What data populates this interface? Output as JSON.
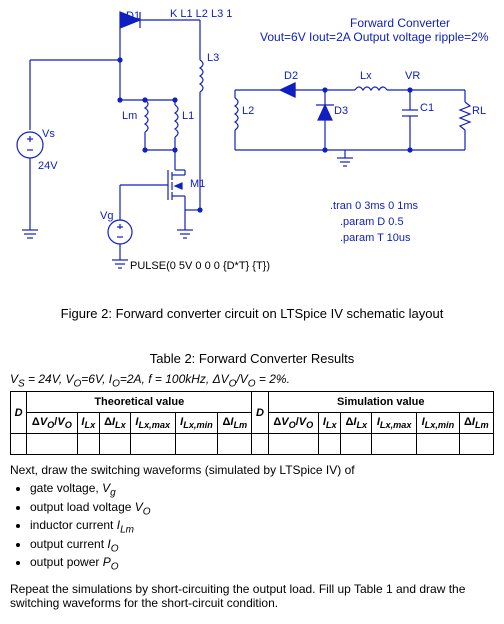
{
  "schematic": {
    "header_coupling": "K L1 L2 L3 1",
    "title1": "Forward Converter",
    "title2": "Vout=6V Iout=2A Output voltage ripple=2%",
    "D1": "D1",
    "D2": "D2",
    "D3": "D3",
    "Lm": "Lm",
    "L1": "L1",
    "L2": "L2",
    "L3": "L3",
    "Lx": "Lx",
    "VR": "VR",
    "C1": "C1",
    "RL": "RL",
    "Vs": "Vs",
    "V24": "24V",
    "M1": "M1",
    "Vg": "Vg",
    "pulse": "PULSE(0 5V 0 0 0 {D*T} {T})",
    "tran": ".tran 0 3ms 0 1ms",
    "paramD": ".param D 0.5",
    "paramT": ".param T 10us"
  },
  "figure_caption": "Figure 2: Forward converter circuit on LTSpice IV schematic layout",
  "table_caption": "Table 2: Forward Converter Results",
  "conditions_html": "V<sub>S</sub> = 24V, V<sub>O</sub>=6V, I<sub>O</sub>=2A, f = 100kHz, ΔV<sub>O</sub>/V<sub>O</sub> = 2%.",
  "table": {
    "group1": "Theoretical value",
    "group2": "Simulation value",
    "cols": [
      "D",
      "ΔV_O/V_O",
      "I_Lx",
      "ΔI_Lx",
      "I_Lx,max",
      "I_Lx,min",
      "ΔI_Lm",
      "D",
      "ΔV_O/V_O",
      "I_Lx",
      "ΔI_Lx",
      "I_Lx,max",
      "I_Lx,min",
      "ΔI_Lm"
    ]
  },
  "next_intro": "Next, draw the switching waveforms (simulated by LTSpice IV) of",
  "bullets": {
    "b1_html": "gate voltage, <i>V<sub>g</sub></i>",
    "b2_html": "output load voltage <i>V<sub>O</sub></i>",
    "b3_html": "inductor current <i>I<sub>Lm</sub></i>",
    "b4_html": "output current <i>I<sub>O</sub></i>",
    "b5_html": "output power <i>P<sub>O</sub></i>"
  },
  "closing": "Repeat the simulations by short-circuiting the output load. Fill up Table 1 and draw the switching waveforms for the short-circuit condition."
}
